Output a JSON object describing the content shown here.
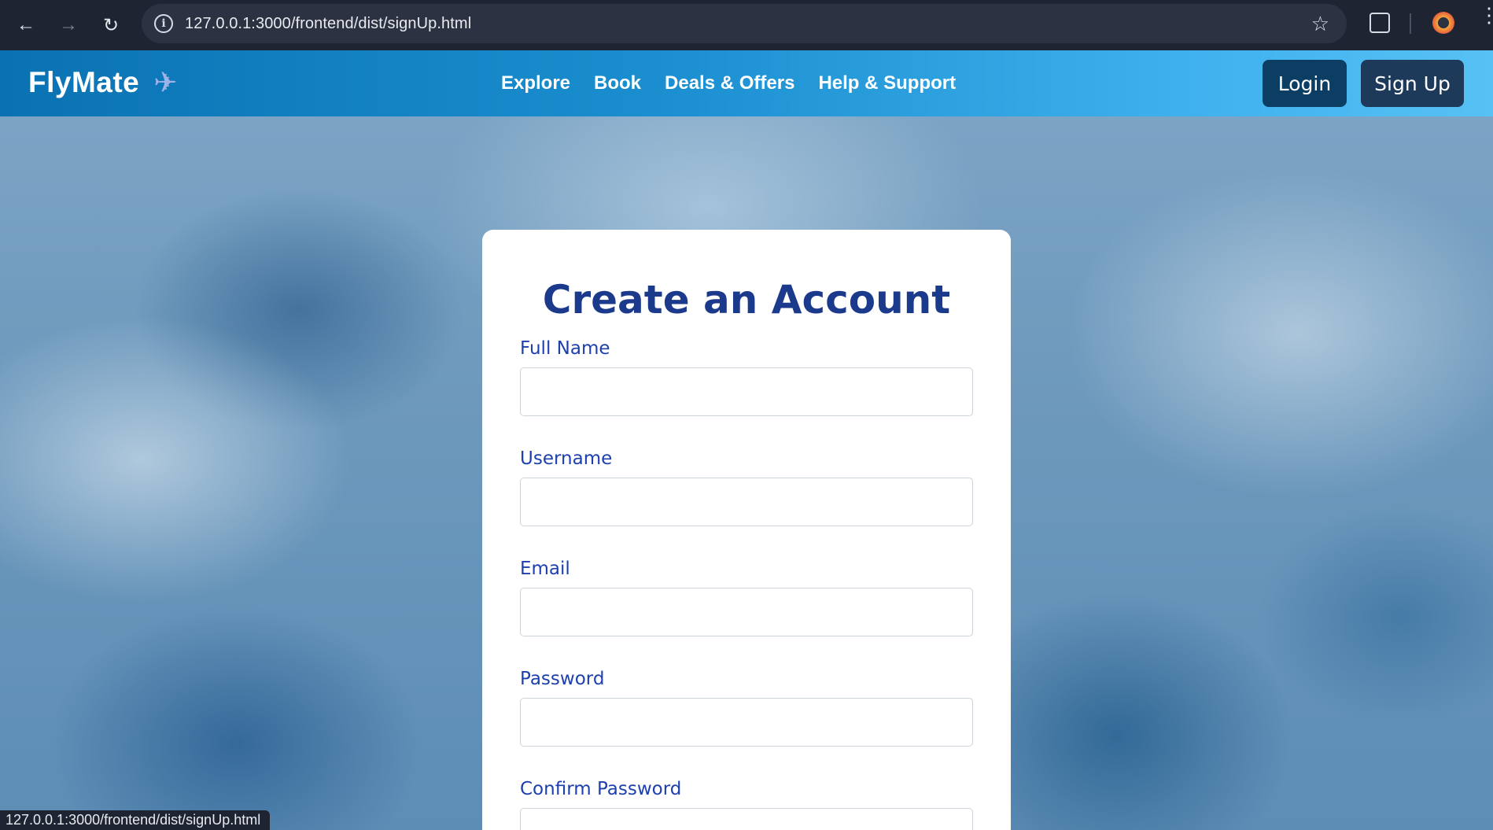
{
  "browser": {
    "url": "127.0.0.1:3000/frontend/dist/signUp.html",
    "status_url": "127.0.0.1:3000/frontend/dist/signUp.html"
  },
  "header": {
    "brand": "FlyMate",
    "brand_icon": "airplane-icon",
    "nav": [
      "Explore",
      "Book",
      "Deals & Offers",
      "Help & Support"
    ],
    "login_label": "Login",
    "signup_label": "Sign Up"
  },
  "form": {
    "title": "Create an Account",
    "fields": [
      {
        "label": "Full Name",
        "value": ""
      },
      {
        "label": "Username",
        "value": ""
      },
      {
        "label": "Email",
        "value": ""
      },
      {
        "label": "Password",
        "value": ""
      },
      {
        "label": "Confirm Password",
        "value": ""
      }
    ]
  },
  "colors": {
    "header_gradient_start": "#0a72b3",
    "header_gradient_end": "#57c1f4",
    "title": "#1b3a8c",
    "label": "#1e40af",
    "login_button": "#0c3d62",
    "signup_button": "#1d3a5a"
  }
}
